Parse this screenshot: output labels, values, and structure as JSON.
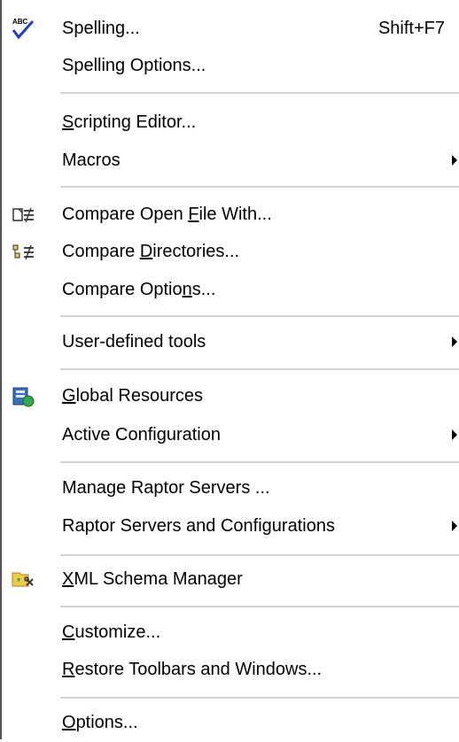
{
  "menu": {
    "spelling": {
      "label": "Spelling...",
      "shortcut": "Shift+F7",
      "icon": "spell-check-icon"
    },
    "spelling_options": {
      "label": "Spelling Options..."
    },
    "scripting_editor": {
      "pre": "",
      "u": "S",
      "post": "cripting Editor..."
    },
    "macros": {
      "label": "Macros"
    },
    "compare_open_file": {
      "pre": "Compare Open ",
      "u": "F",
      "post": "ile With...",
      "icon": "compare-file-icon"
    },
    "compare_directories": {
      "pre": "Compare ",
      "u": "D",
      "post": "irectories...",
      "icon": "compare-directories-icon"
    },
    "compare_options": {
      "pre": "Compare Optio",
      "u": "n",
      "post": "s..."
    },
    "user_defined_tools": {
      "label": "User-defined tools"
    },
    "global_resources": {
      "pre": "",
      "u": "G",
      "post": "lobal Resources",
      "icon": "global-resources-icon"
    },
    "active_configuration": {
      "label": "Active Configuration"
    },
    "manage_raptor": {
      "label": "Manage Raptor Servers ..."
    },
    "raptor_configs": {
      "label": "Raptor Servers and Configurations"
    },
    "xml_schema_manager": {
      "pre": "",
      "u": "X",
      "post": "ML Schema Manager",
      "icon": "xml-schema-manager-icon"
    },
    "customize": {
      "pre": "",
      "u": "C",
      "post": "ustomize..."
    },
    "restore_toolbars": {
      "pre": "",
      "u": "R",
      "post": "estore Toolbars and Windows..."
    },
    "options": {
      "pre": "",
      "u": "O",
      "post": "ptions..."
    }
  }
}
